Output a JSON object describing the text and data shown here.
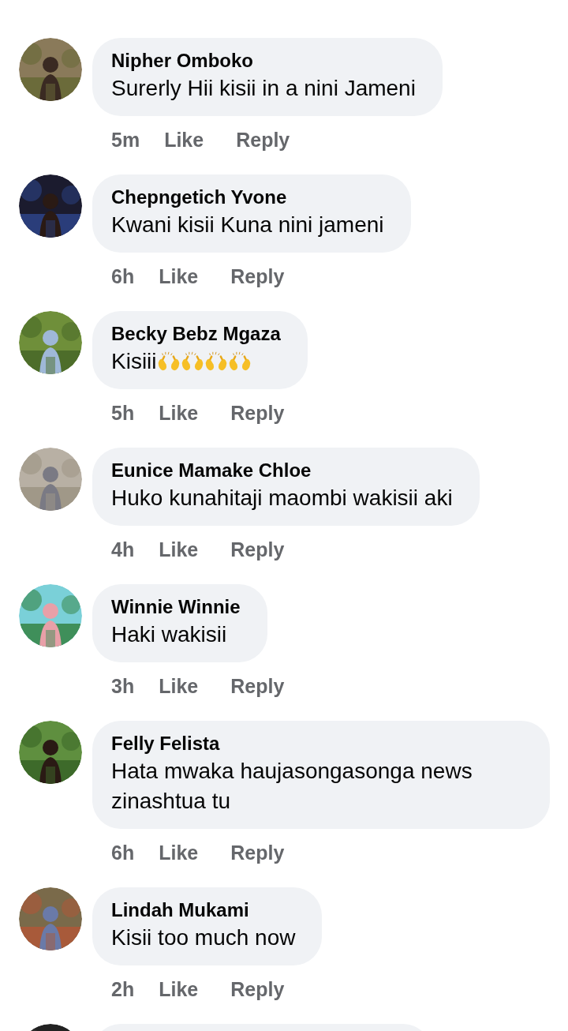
{
  "comments": [
    {
      "kind": "comment",
      "author": "Nipher Omboko",
      "text": "Surerly Hii kisii in a nini Jameni",
      "time": "5m",
      "actions": [
        "Like",
        "Reply"
      ]
    },
    {
      "kind": "comment",
      "author": "Chepngetich Yvone",
      "text": "Kwani kisii Kuna nini jameni",
      "time": "6h",
      "actions": [
        "Like",
        "Reply"
      ]
    },
    {
      "kind": "comment",
      "author": "Becky Bebz Mgaza",
      "text": "Kisiii",
      "emojis": [
        {
          "kind": "raising-hands"
        },
        {
          "kind": "raising-hands"
        },
        {
          "kind": "raising-hands"
        },
        {
          "kind": "raising-hands"
        }
      ],
      "time": "5h",
      "actions": [
        "Like",
        "Reply"
      ]
    },
    {
      "kind": "comment",
      "author": "Eunice Mamake Chloe",
      "text": "Huko kunahitaji maombi wakisii aki",
      "time": "4h",
      "actions": [
        "Like",
        "Reply"
      ]
    },
    {
      "kind": "comment",
      "author": "Winnie Winnie",
      "text": "Haki wakisii",
      "time": "3h",
      "actions": [
        "Like",
        "Reply"
      ]
    },
    {
      "kind": "comment",
      "author": "Felly Felista",
      "text": "Hata mwaka haujasongasonga news zinashtua tu",
      "time": "6h",
      "actions": [
        "Like",
        "Reply"
      ]
    },
    {
      "kind": "comment",
      "author": "Lindah Mukami",
      "text": "Kisii too much now",
      "time": "2h",
      "actions": [
        "Like",
        "Reply"
      ]
    },
    {
      "kind": "partial"
    }
  ]
}
